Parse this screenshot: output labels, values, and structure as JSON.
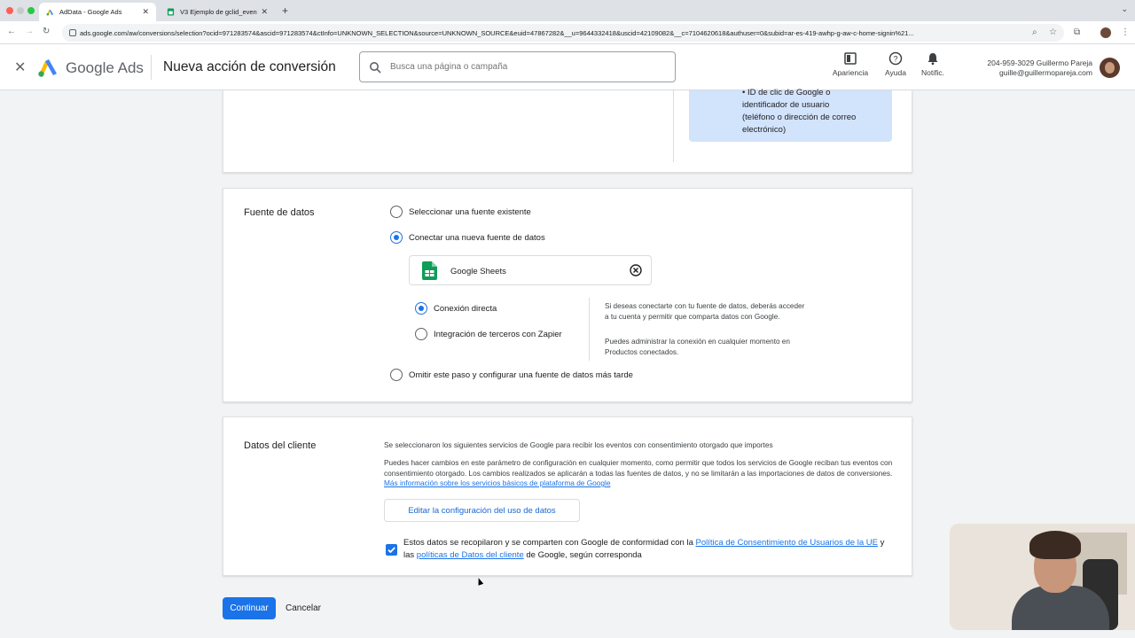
{
  "browser": {
    "tabs": [
      {
        "title": "AdData - Google Ads",
        "active": true
      },
      {
        "title": "V3 Ejemplo de gclid_events -",
        "active": false
      }
    ],
    "url": "ads.google.com/aw/conversions/selection?ocid=971283574&ascid=971283574&ctInfo=UNKNOWN_SELECTION&source=UNKNOWN_SOURCE&euid=4786728​2&__u=9644332418&uscid=42109082&__c=7104620618&authuser=0&subid=ar-es-419-awhp-g-aw-c-home-signin%21..."
  },
  "header": {
    "brand": "Google Ads",
    "page_title": "Nueva acción de conversión",
    "search_placeholder": "Busca una página o campaña",
    "icons": [
      {
        "label": "Apariencia",
        "icon": "appearance-icon"
      },
      {
        "label": "Ayuda",
        "icon": "help-icon"
      },
      {
        "label": "Notific.",
        "icon": "bell-icon"
      }
    ],
    "account_line1": "204-959-3029 Guillermo Pareja",
    "account_line2": "guille@guillermopareja.com"
  },
  "identifier_box": {
    "line1": "• ID de clic de Google o",
    "line2": "identificador de usuario",
    "line3": "(teléfono o dirección de correo",
    "line4": "electrónico)"
  },
  "data_source": {
    "heading": "Fuente de datos",
    "options": [
      {
        "label": "Seleccionar una fuente existente",
        "selected": false
      },
      {
        "label": "Conectar una nueva fuente de datos",
        "selected": true
      },
      {
        "label": "Omitir este paso y configurar una fuente de datos más tarde",
        "selected": false
      }
    ],
    "source_name": "Google Sheets",
    "connection_options": [
      {
        "label": "Conexión directa",
        "selected": true
      },
      {
        "label": "Integración de terceros con Zapier",
        "selected": false
      }
    ],
    "note1": "Si deseas conectarte con tu fuente de datos, deberás acceder a tu cuenta y permitir que comparta datos con Google.",
    "note2": "Puedes administrar la conexión en cualquier momento en Productos conectados."
  },
  "customer_data": {
    "heading": "Datos del cliente",
    "desc1": "Se seleccionaron los siguientes servicios de Google para recibir los eventos con consentimiento otorgado que importes",
    "desc2": "Puedes hacer cambios en este parámetro de configuración en cualquier momento, como permitir que todos los servicios de Google reciban tus eventos con consentimiento otorgado. Los cambios realizados se aplicarán a todas las fuentes de datos, y no se limitarán a las importaciones de datos de conversiones.",
    "desc2_link": "Más información sobre los servicios básicos de plataforma de Google",
    "edit_button": "Editar la configuración del uso de datos",
    "consent_checked": true,
    "consent_part1": "Estos datos se recopilaron y se comparten con Google de conformidad con la",
    "consent_link1": "Política de Consentimiento de Usuarios de la UE",
    "consent_part2": "y las",
    "consent_link2": "políticas de Datos del cliente",
    "consent_part3": "de Google, según corresponda"
  },
  "actions": {
    "continue": "Continuar",
    "cancel": "Cancelar"
  },
  "colors": {
    "primary": "#1a73e8",
    "info_bg": "#d2e3fc"
  }
}
